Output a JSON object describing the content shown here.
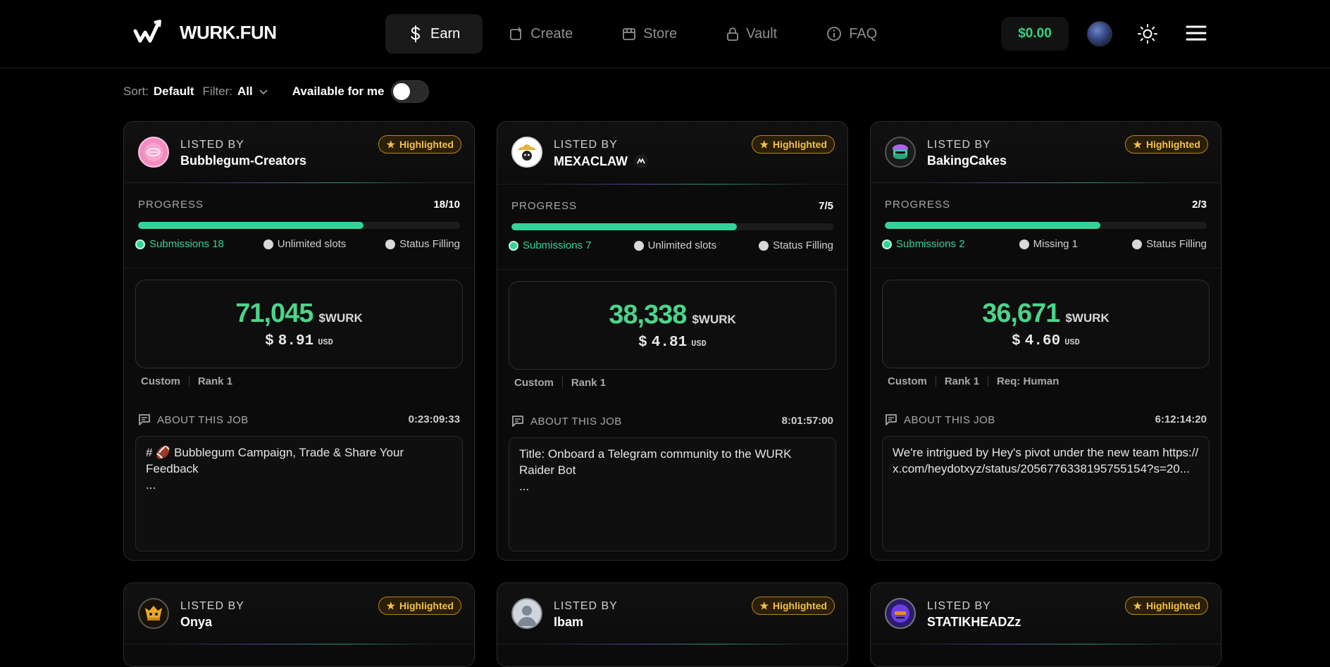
{
  "header": {
    "logo_text": "WURK.FUN",
    "nav": [
      {
        "label": "Earn",
        "icon": "dollar-icon",
        "active": true
      },
      {
        "label": "Create",
        "icon": "create-icon",
        "active": false
      },
      {
        "label": "Store",
        "icon": "store-icon",
        "active": false
      },
      {
        "label": "Vault",
        "icon": "lock-icon",
        "active": false
      },
      {
        "label": "FAQ",
        "icon": "info-icon",
        "active": false
      }
    ],
    "balance": "$0.00"
  },
  "toolbar": {
    "sort_label": "Sort:",
    "sort_value": "Default",
    "filter_label": "Filter:",
    "filter_value": "All",
    "available_label": "Available for me",
    "available_on": false
  },
  "common": {
    "listed_by": "LISTED BY",
    "highlighted": "Highlighted",
    "progress": "PROGRESS",
    "about": "ABOUT THIS JOB",
    "currency": "$WURK",
    "usd_symbol": "$",
    "usd_label": "USD"
  },
  "cards": [
    {
      "lister": "Bubblegum-Creators",
      "progress": "18/10",
      "fill": 0.7,
      "submissions": "Submissions 18",
      "slots": "Unlimited slots",
      "status": "Status Filling",
      "amount": "71,045",
      "usd": "8.91",
      "tags": [
        "Custom",
        "Rank 1"
      ],
      "timer": "0:23:09:33",
      "description": "# 🏈 Bubblegum Campaign, Trade & Share Your Feedback\n..."
    },
    {
      "lister": "MEXACLAW",
      "progress": "7/5",
      "fill": 0.7,
      "submissions": "Submissions 7",
      "slots": "Unlimited slots",
      "status": "Status Filling",
      "amount": "38,338",
      "usd": "4.81",
      "tags": [
        "Custom",
        "Rank 1"
      ],
      "timer": "8:01:57:00",
      "description": "Title: Onboard a Telegram community to the WURK Raider Bot\n..."
    },
    {
      "lister": "BakingCakes",
      "progress": "2/3",
      "fill": 0.67,
      "submissions": "Submissions 2",
      "slots": "Missing 1",
      "status": "Status Filling",
      "amount": "36,671",
      "usd": "4.60",
      "tags": [
        "Custom",
        "Rank 1",
        "Req: Human"
      ],
      "timer": "6:12:14:20",
      "description": "We're intrigued by Hey's pivot under the new team https://x.com/heydotxyz/status/2056776338195755154?s=20..."
    }
  ],
  "next_cards": [
    {
      "lister": "Onya"
    },
    {
      "lister": "Ibam"
    },
    {
      "lister": "STATIKHEADZz"
    }
  ],
  "colors": {
    "accent": "#34d399",
    "highlight": "#f2c14e",
    "background": "#000000"
  }
}
